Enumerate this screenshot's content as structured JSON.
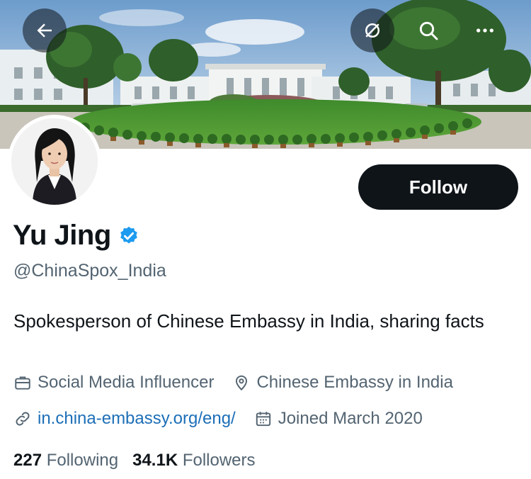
{
  "header": {
    "back_icon": "arrow-left-icon",
    "spaces_icon": "spaces-off-icon",
    "search_icon": "search-icon",
    "more_icon": "more-horizontal-icon"
  },
  "profile": {
    "display_name": "Yu Jing",
    "handle": "@ChinaSpox_India",
    "verified": true,
    "bio": "Spokesperson of Chinese Embassy in India, sharing facts",
    "category": "Social Media Influencer",
    "location": "Chinese Embassy in India",
    "website": "in.china-embassy.org/eng/",
    "joined": "Joined March 2020"
  },
  "actions": {
    "follow_label": "Follow"
  },
  "stats": {
    "following_count": "227",
    "following_label": "Following",
    "followers_count": "34.1K",
    "followers_label": "Followers"
  },
  "colors": {
    "verified_badge": "#1d9bf0",
    "link": "#1d6fb8",
    "secondary_text": "#536471",
    "follow_bg": "#0f1419"
  }
}
